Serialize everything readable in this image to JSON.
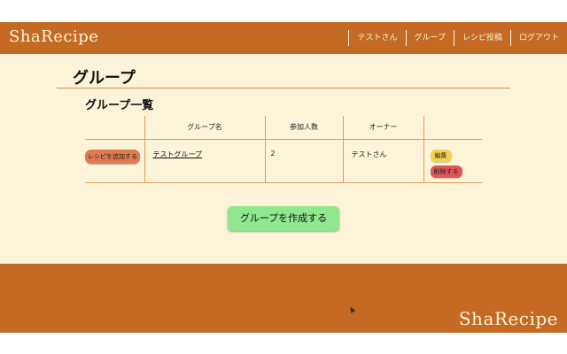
{
  "header": {
    "brand": "ShaRecipe",
    "nav": [
      "テストさん",
      "グループ",
      "レシピ投稿",
      "ログアウト"
    ]
  },
  "main": {
    "page_title": "グループ",
    "section_title": "グループ一覧",
    "table": {
      "headers": [
        "",
        "グループ名",
        "参加人数",
        "オーナー",
        ""
      ],
      "rows": [
        {
          "add_recipe_label": "レシピを追加する",
          "group_name": "テストグループ",
          "members": "2",
          "owner": "テストさん",
          "edit_label": "編集",
          "delete_label": "削除する"
        }
      ]
    },
    "create_button_label": "グループを作成する"
  },
  "footer": {
    "brand": "ShaRecipe"
  },
  "colors": {
    "header_bg": "#c46a24",
    "main_bg": "#fcf4d9",
    "add_button": "#e07a50",
    "edit_button": "#f5d04e",
    "delete_button": "#e05658",
    "create_button": "#8fe88e"
  }
}
